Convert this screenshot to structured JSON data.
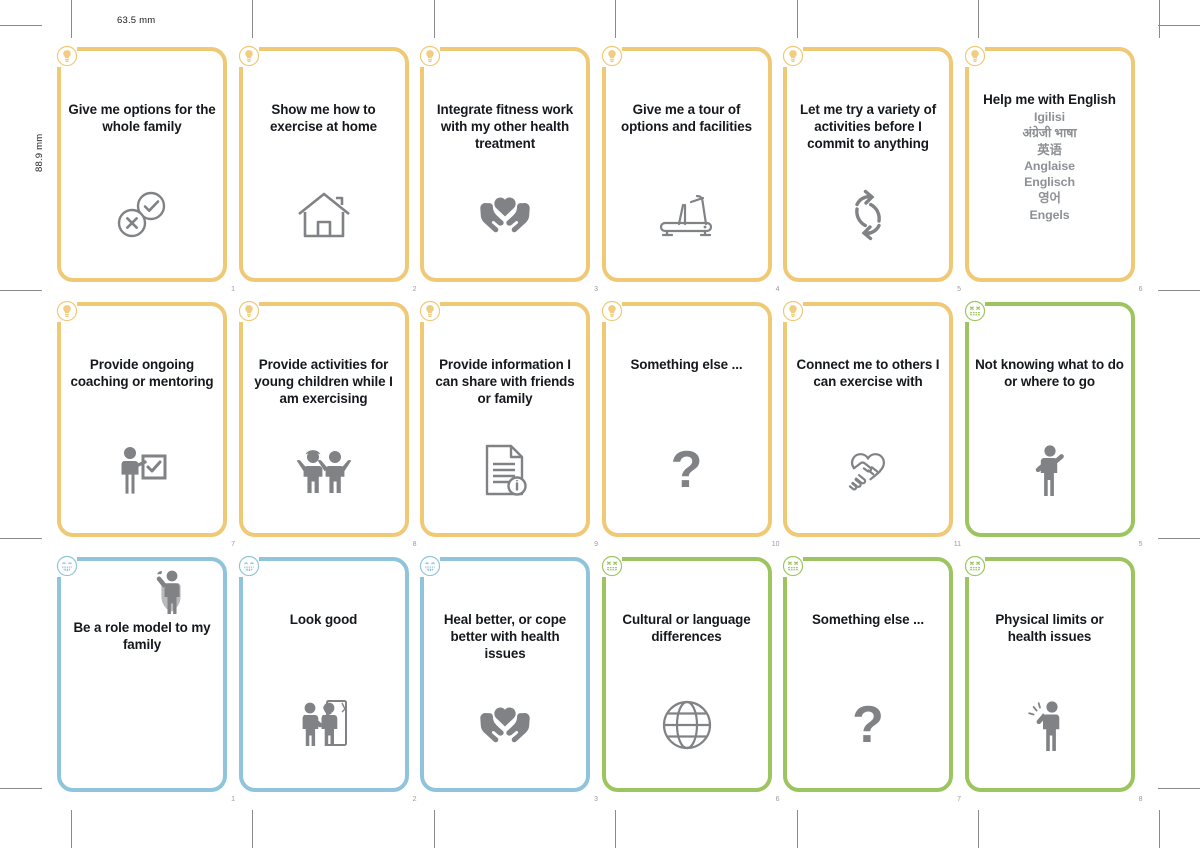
{
  "sheet": {
    "width_label": "63.5 mm",
    "height_label": "88.9 mm",
    "background": "#ffffff"
  },
  "palette": {
    "gold": "#EFC976",
    "blue": "#8FC4DC",
    "green": "#9CC55F",
    "icon_gray": "#808285",
    "title_black": "#15181c",
    "subtitle_gray": "#8d9095",
    "number_gray": "#9b9b9b",
    "crop_mark": "#8a8a8a"
  },
  "legend": {
    "gold_badge": "lightbulb-icon",
    "blue_badge": "grinning-face-icon",
    "green_badge": "frustrated-face-icon"
  },
  "rows": [
    {
      "name": "row-1",
      "cards": [
        {
          "title": "Give me options for the whole family",
          "number": "1",
          "color": "gold",
          "badge": "lightbulb-icon",
          "art": "check-cross-circles-icon"
        },
        {
          "title": "Show me how to exercise at home",
          "number": "2",
          "color": "gold",
          "badge": "lightbulb-icon",
          "art": "house-icon"
        },
        {
          "title": "Integrate fitness work with my other health treatment",
          "number": "3",
          "color": "gold",
          "badge": "lightbulb-icon",
          "art": "heart-in-hands-icon"
        },
        {
          "title": "Give me a tour of options and facilities",
          "number": "4",
          "color": "gold",
          "badge": "lightbulb-icon",
          "art": "treadmill-icon"
        },
        {
          "title": "Let me try a variety of activities before I commit to anything",
          "number": "5",
          "color": "gold",
          "badge": "lightbulb-icon",
          "art": "cycle-arrows-icon"
        },
        {
          "title": "Help me with English",
          "number": "6",
          "color": "gold",
          "badge": "lightbulb-icon",
          "art": "none",
          "subtitles": [
            "Igilisi",
            "अंग्रेजी भाषा",
            "英语",
            "Anglaise",
            "Englisch",
            "영어",
            "Engels"
          ]
        }
      ]
    },
    {
      "name": "row-2",
      "cards": [
        {
          "title": "Provide ongoing coaching or mentoring",
          "number": "7",
          "color": "gold",
          "badge": "lightbulb-icon",
          "art": "coach-presenting-icon"
        },
        {
          "title": "Provide activities for young children while I am exercising",
          "number": "8",
          "color": "gold",
          "badge": "lightbulb-icon",
          "art": "two-children-icon"
        },
        {
          "title": "Provide information I can share with friends or family",
          "number": "9",
          "color": "gold",
          "badge": "lightbulb-icon",
          "art": "document-info-icon"
        },
        {
          "title": "Something else ...",
          "number": "10",
          "color": "gold",
          "badge": "lightbulb-icon",
          "art": "question-mark-icon"
        },
        {
          "title": "Connect me to others I can exercise with",
          "number": "11",
          "color": "gold",
          "badge": "lightbulb-icon",
          "art": "handshake-heart-icon"
        },
        {
          "title": "Not knowing what to do or where to go",
          "number": "5",
          "color": "green",
          "badge": "frustrated-face-icon",
          "art": "person-looking-icon"
        }
      ]
    },
    {
      "name": "row-3",
      "cards": [
        {
          "title": "Be a role model to my family",
          "number": "1",
          "color": "blue",
          "badge": "grinning-face-icon",
          "art": "superhero-icon"
        },
        {
          "title": "Look good",
          "number": "2",
          "color": "blue",
          "badge": "grinning-face-icon",
          "art": "mirror-person-icon"
        },
        {
          "title": "Heal better, or cope better with health issues",
          "number": "3",
          "color": "blue",
          "badge": "grinning-face-icon",
          "art": "heart-in-hands-icon"
        },
        {
          "title": "Cultural or language differences",
          "number": "6",
          "color": "green",
          "badge": "frustrated-face-icon",
          "art": "globe-icon"
        },
        {
          "title": "Something else ...",
          "number": "7",
          "color": "green",
          "badge": "frustrated-face-icon",
          "art": "question-mark-icon"
        },
        {
          "title": "Physical limits or health issues",
          "number": "8",
          "color": "green",
          "badge": "frustrated-face-icon",
          "art": "person-in-pain-icon"
        }
      ]
    }
  ]
}
